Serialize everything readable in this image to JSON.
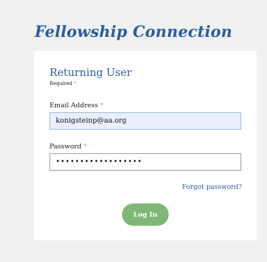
{
  "app_title": "Fellowship Connection",
  "login_form": {
    "section_title": "Returning User",
    "required_note": "Required",
    "required_marker": "*",
    "email": {
      "label": "Email Address",
      "value": "konigsteinp@aa.org"
    },
    "password": {
      "label": "Password",
      "value": "••••••••••••••••••"
    },
    "forgot_password_label": "Forgot password?",
    "login_button_label": "Log In"
  },
  "colors": {
    "brand_blue": "#2a5d9f",
    "button_green": "#7fb875",
    "required_marker": "#e3857a",
    "autofill_background": "#e8f0fe"
  }
}
